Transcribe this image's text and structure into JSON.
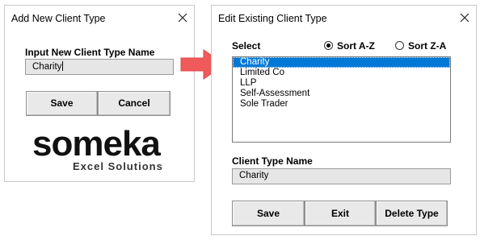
{
  "add_dialog": {
    "title": "Add New Client Type",
    "input_label": "Input New Client Type Name",
    "input_value": "Charity",
    "save_label": "Save",
    "cancel_label": "Cancel"
  },
  "logo": {
    "word": "someka",
    "tagline": "Excel Solutions"
  },
  "edit_dialog": {
    "title": "Edit Existing Client Type",
    "select_label": "Select",
    "sort_options": [
      {
        "label": "Sort A-Z",
        "selected": true
      },
      {
        "label": "Sort Z-A",
        "selected": false
      }
    ],
    "client_types": [
      "Charity",
      "Limited Co",
      "LLP",
      "Self-Assessment",
      "Sole Trader"
    ],
    "selected_index": 0,
    "name_label": "Client Type Name",
    "name_value": "Charity",
    "save_label": "Save",
    "exit_label": "Exit",
    "delete_label": "Delete Type"
  },
  "colors": {
    "arrow": "#f05a5a",
    "selection": "#0078d7",
    "button_face": "#e9e9e9"
  }
}
